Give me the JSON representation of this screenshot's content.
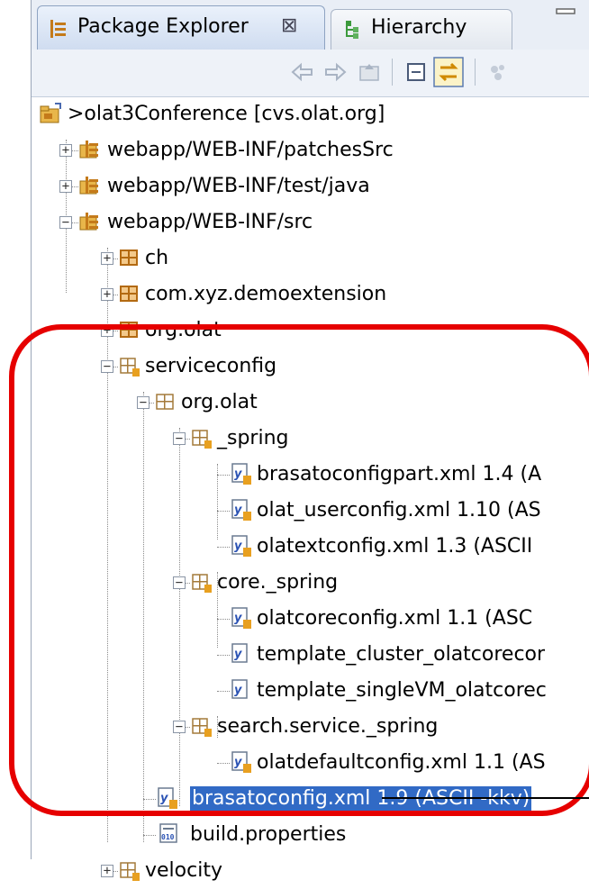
{
  "tabs": [
    {
      "label": "Package Explorer",
      "close": "⊠",
      "icon": "package-explorer-icon",
      "active": true
    },
    {
      "label": "Hierarchy",
      "icon": "hierarchy-icon",
      "active": false
    }
  ],
  "toolbar": {
    "buttons": [
      "back-arrow-icon",
      "forward-arrow-icon",
      "up-folder-icon",
      "collapse-all-icon",
      "link-with-editor-icon",
      "view-menu-icon"
    ]
  },
  "tree": {
    "project": ">olat3Conference  [cvs.olat.org]",
    "source_folders": [
      "webapp/WEB-INF/patchesSrc",
      "webapp/WEB-INF/test/java",
      "webapp/WEB-INF/src"
    ],
    "packages": [
      "ch",
      "com.xyz.demoextension",
      "org.olat",
      "serviceconfig"
    ],
    "serviceconfig_child": "org.olat",
    "spring": "_spring",
    "spring_files": [
      "brasatoconfigpart.xml  1.4  (A",
      "olat_userconfig.xml  1.10  (AS",
      "olatextconfig.xml  1.3  (ASCII"
    ],
    "core_spring": "core._spring",
    "core_files": [
      "olatcoreconfig.xml  1.1  (ASC",
      "template_cluster_olatcorecor",
      "template_singleVM_olatcorec"
    ],
    "search_spring": "search.service._spring",
    "search_files": [
      "olatdefaultconfig.xml  1.1  (AS"
    ],
    "selected_file": "brasatoconfig.xml  1.9  (ASCII -kkv)",
    "build_file": "build.properties",
    "velocity": "velocity"
  },
  "colors": {
    "selection": "#316ac5",
    "annotation": "#e60000",
    "package_orange": "#e07a10"
  }
}
